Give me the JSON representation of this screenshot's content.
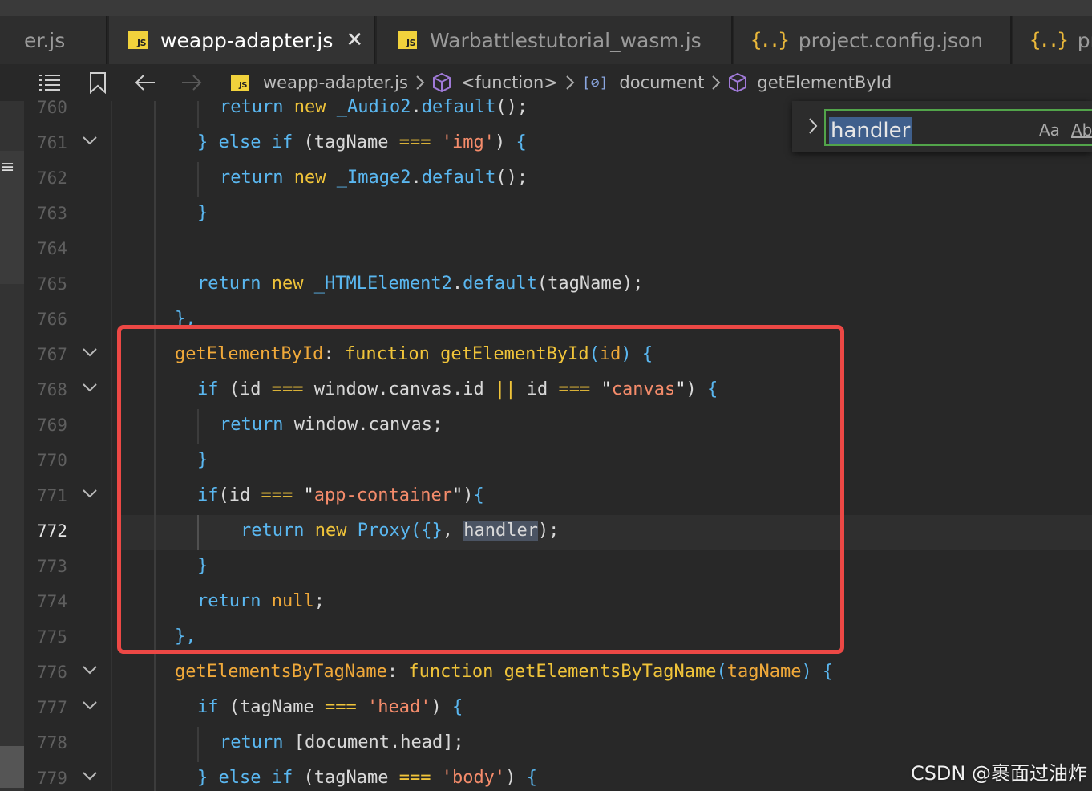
{
  "tabs": [
    {
      "label": "er.js",
      "icon": "none",
      "active": false
    },
    {
      "label": "weapp-adapter.js",
      "icon": "js-file-icon",
      "active": true
    },
    {
      "label": "Warbattlestutorial_wasm.js",
      "icon": "js-file-icon",
      "active": false
    },
    {
      "label": "project.config.json",
      "icon": "json-file-icon",
      "active": false
    },
    {
      "label": "pro",
      "icon": "json-file-icon",
      "active": false
    }
  ],
  "icon_text": {
    "js": "JS",
    "json": "{..}",
    "close": "✕",
    "field": "[⊘]",
    "activity": "≡"
  },
  "breadcrumb": {
    "file": "weapp-adapter.js",
    "scope": "<function>",
    "variable": "document",
    "method": "getElementById"
  },
  "find": {
    "value": "handler",
    "match_case_label": "Aa",
    "whole_word_label": "Ab"
  },
  "lines": [
    {
      "num": "760"
    },
    {
      "num": "761"
    },
    {
      "num": "762"
    },
    {
      "num": "763"
    },
    {
      "num": "764"
    },
    {
      "num": "765"
    },
    {
      "num": "766"
    },
    {
      "num": "767"
    },
    {
      "num": "768"
    },
    {
      "num": "769"
    },
    {
      "num": "770"
    },
    {
      "num": "771"
    },
    {
      "num": "772"
    },
    {
      "num": "773"
    },
    {
      "num": "774"
    },
    {
      "num": "775"
    },
    {
      "num": "776"
    },
    {
      "num": "777"
    },
    {
      "num": "778"
    },
    {
      "num": "779"
    }
  ],
  "current_line": "772",
  "code": {
    "l760": [
      "return",
      " ",
      "new",
      " ",
      "_Audio2",
      ".",
      "default",
      "();"
    ],
    "l761": [
      "}",
      " ",
      "else",
      " ",
      "if",
      " (",
      "tagName",
      " ",
      "===",
      " ",
      "'img'",
      ") ",
      "{"
    ],
    "l762": [
      "return",
      " ",
      "new",
      " ",
      "_Image2",
      ".",
      "default",
      "();"
    ],
    "l763": [
      "}"
    ],
    "l765": [
      "return",
      " ",
      "new",
      " ",
      "_HTMLElement2",
      ".",
      "default",
      "(",
      "tagName",
      ");"
    ],
    "l766": [
      "},"
    ],
    "l767": [
      "getElementById",
      ": ",
      "function",
      " ",
      "getElementById",
      "(",
      "id",
      ") ",
      "{"
    ],
    "l768": [
      "if",
      " (",
      "id",
      " ",
      "===",
      " ",
      "window",
      ".",
      "canvas",
      ".",
      "id",
      " ",
      "||",
      " ",
      "id",
      " ",
      "===",
      " ",
      "\"",
      "canvas",
      "\"",
      ") ",
      "{"
    ],
    "l769": [
      "return",
      " ",
      "window",
      ".",
      "canvas",
      ";"
    ],
    "l770": [
      "}"
    ],
    "l771": [
      "if",
      "(",
      "id",
      " ",
      "===",
      " ",
      "\"",
      "app-container",
      "\"",
      ")",
      "{"
    ],
    "l772": [
      "return",
      " ",
      "new",
      " ",
      "Proxy",
      "(",
      "{}",
      ", ",
      "handler",
      ");"
    ],
    "l773": [
      "}"
    ],
    "l774": [
      "return",
      " ",
      "null",
      ";"
    ],
    "l775": [
      "},"
    ],
    "l776": [
      "getElementsByTagName",
      ": ",
      "function",
      " ",
      "getElementsByTagName",
      "(",
      "tagName",
      ") ",
      "{"
    ],
    "l777": [
      "if",
      " (",
      "tagName",
      " ",
      "===",
      " ",
      "'head'",
      ") ",
      "{"
    ],
    "l778": [
      "return",
      " [",
      "document",
      ".",
      "head",
      "];"
    ],
    "l779": [
      "}",
      " ",
      "else",
      " ",
      "if",
      " (",
      "tagName",
      " ",
      "===",
      " ",
      "'body'",
      ") ",
      "{"
    ]
  },
  "watermark": "CSDN @裹面过油炸",
  "colors": {
    "keyword": "#f0c43a",
    "string": "#f58c6b",
    "annotation": "#ec4845",
    "find_border": "#52a44a",
    "selection": "#4b5463"
  }
}
